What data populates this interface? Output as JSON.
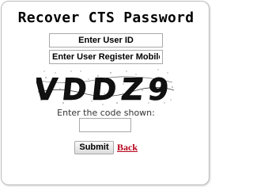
{
  "form": {
    "title": "Recover CTS Password",
    "userid_placeholder": "Enter User ID",
    "mobile_placeholder": "Enter User Register Mobile no",
    "captcha_text": "VDDZ9",
    "code_prompt": "Enter the code shown:",
    "code_value": "",
    "submit_label": "Submit",
    "back_label": "Back"
  },
  "colors": {
    "back_link": "#b5001a",
    "border": "#bdbdbd"
  }
}
